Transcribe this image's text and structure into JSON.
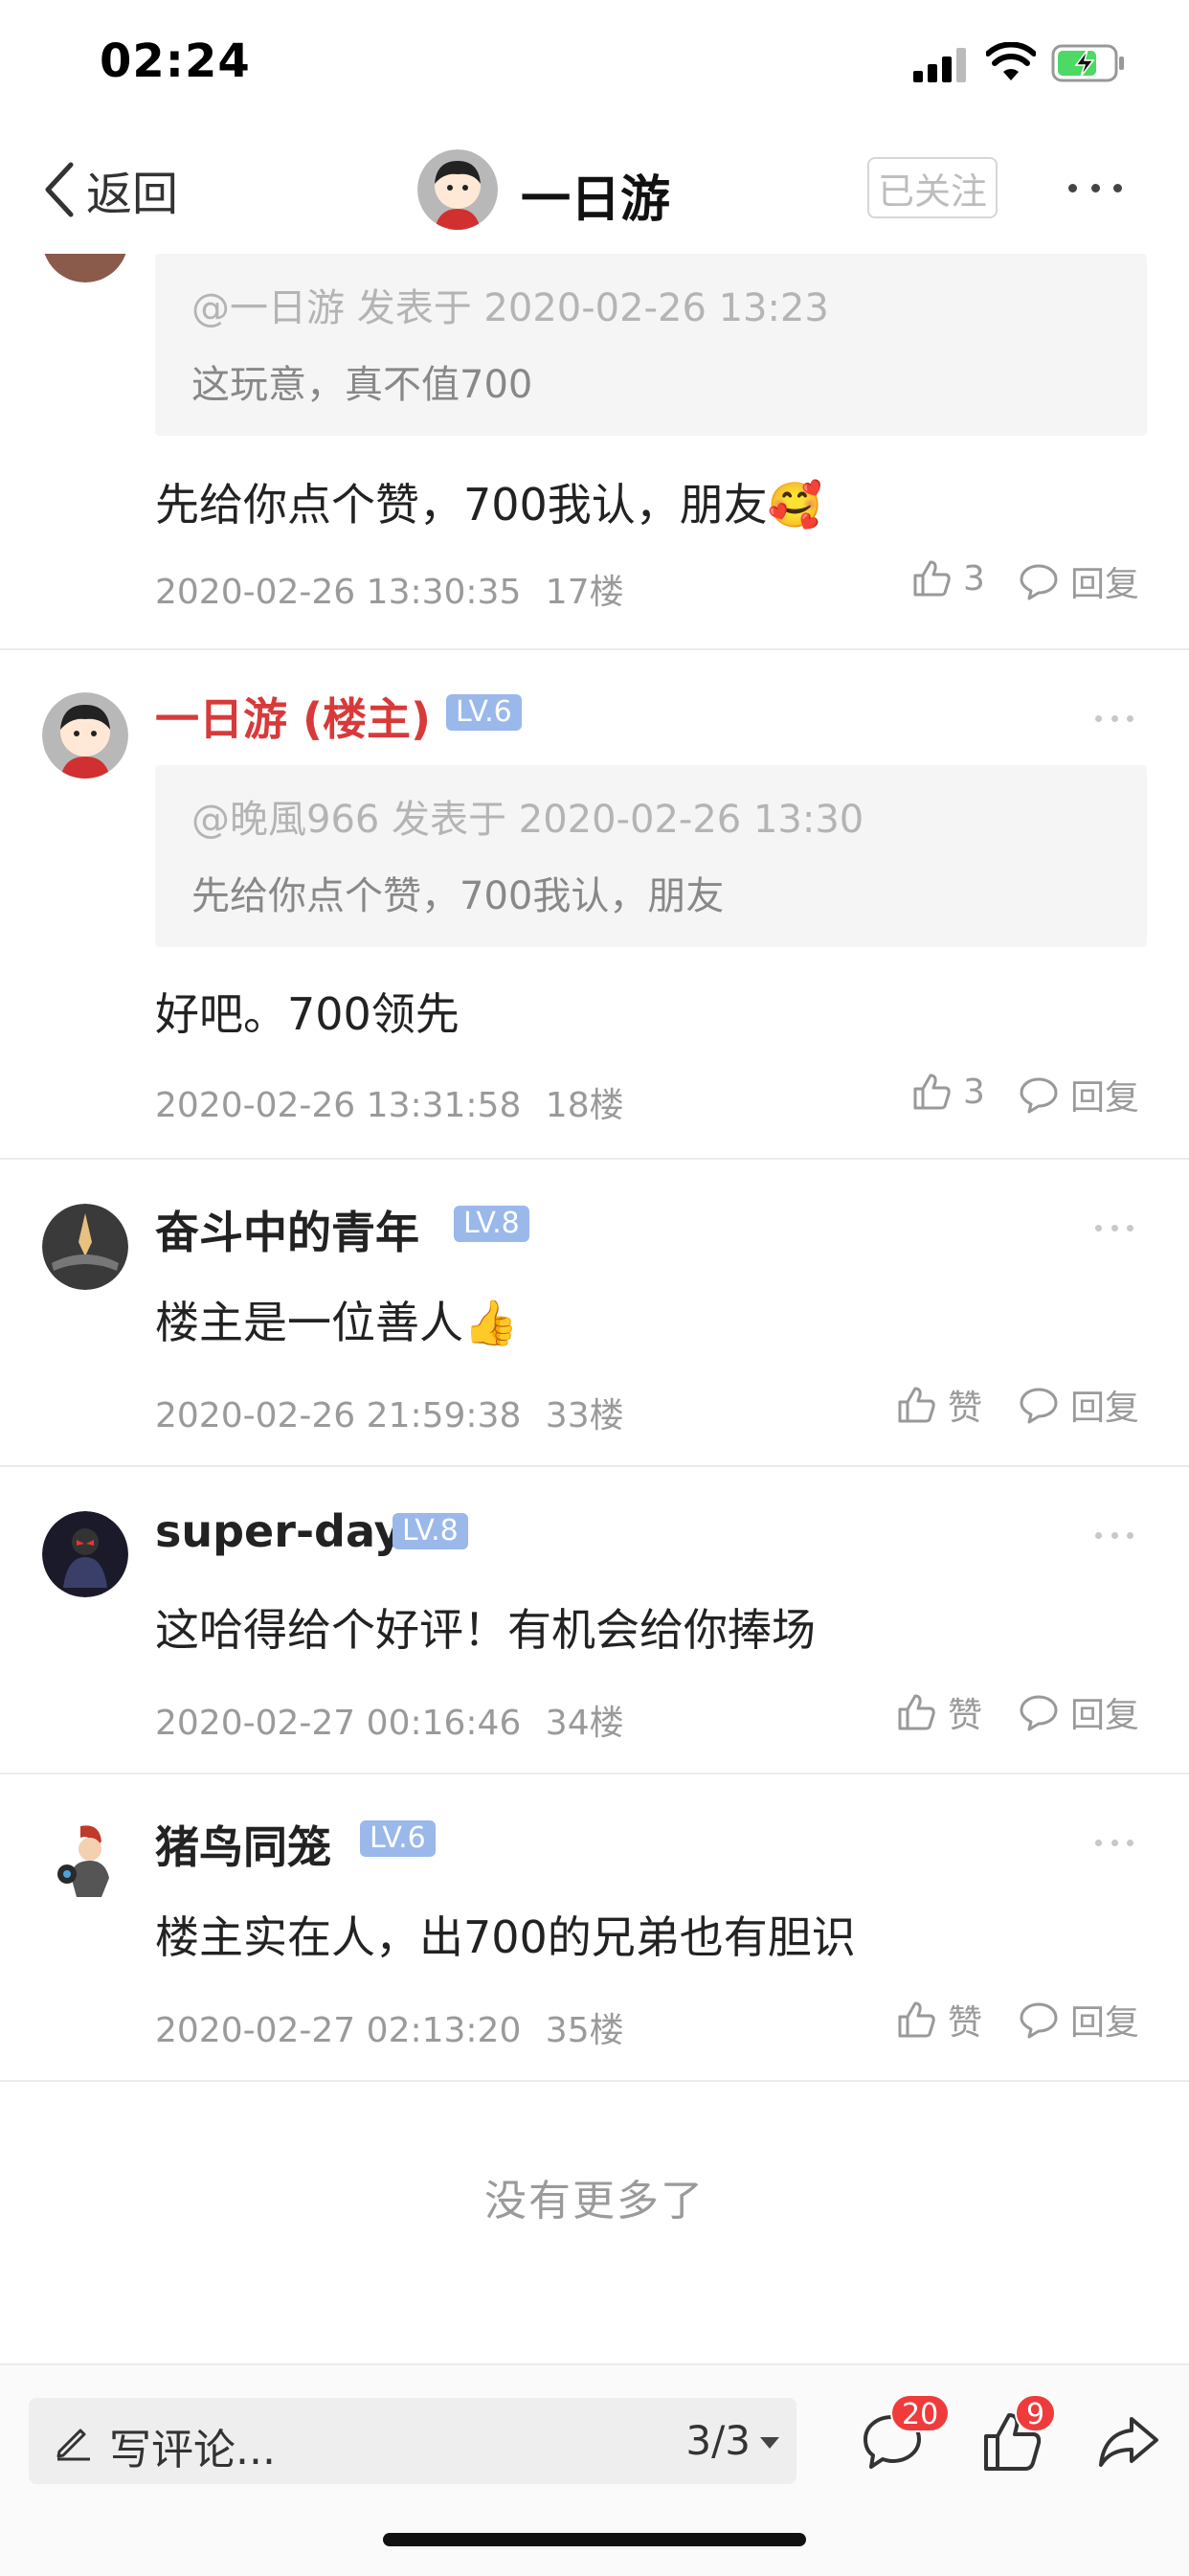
{
  "status_bar": {
    "time": "02:24"
  },
  "nav": {
    "back_label": "返回",
    "title": "一日游",
    "follow_label": "已关注"
  },
  "comments": [
    {
      "quote_meta": "@一日游 发表于 2020-02-26 13:23",
      "quote_text": "这玩意，真不值700",
      "body": "先给你点个赞，700我认，朋友🥰",
      "time": "2020-02-26 13:30:35",
      "floor": "17楼",
      "likes": "3",
      "reply_label": "回复"
    },
    {
      "name": "一日游 (楼主)",
      "level": "LV.6",
      "quote_meta": "@晚風966 发表于 2020-02-26 13:30",
      "quote_text": "先给你点个赞，700我认，朋友",
      "body": "好吧。700领先",
      "time": "2020-02-26 13:31:58",
      "floor": "18楼",
      "likes": "3",
      "reply_label": "回复"
    },
    {
      "name": "奋斗中的青年",
      "level": "LV.8",
      "body": "楼主是一位善人👍",
      "time": "2020-02-26 21:59:38",
      "floor": "33楼",
      "likes": "赞",
      "reply_label": "回复"
    },
    {
      "name": "super-day",
      "level": "LV.8",
      "body": "这哈得给个好评！有机会给你捧场",
      "time": "2020-02-27 00:16:46",
      "floor": "34楼",
      "likes": "赞",
      "reply_label": "回复"
    },
    {
      "name": "猪鸟同笼",
      "level": "LV.6",
      "body": "楼主实在人，出700的兄弟也有胆识",
      "time": "2020-02-27 02:13:20",
      "floor": "35楼",
      "likes": "赞",
      "reply_label": "回复"
    }
  ],
  "footer_note": "没有更多了",
  "bottom_bar": {
    "input_placeholder": "写评论...",
    "page_indicator": "3/3",
    "comments_badge": "20",
    "likes_badge": "9"
  },
  "colors": {
    "op_name": "#d83a3a",
    "level_badge": "#9ab8ea",
    "notification_badge": "#ef3b3b"
  }
}
